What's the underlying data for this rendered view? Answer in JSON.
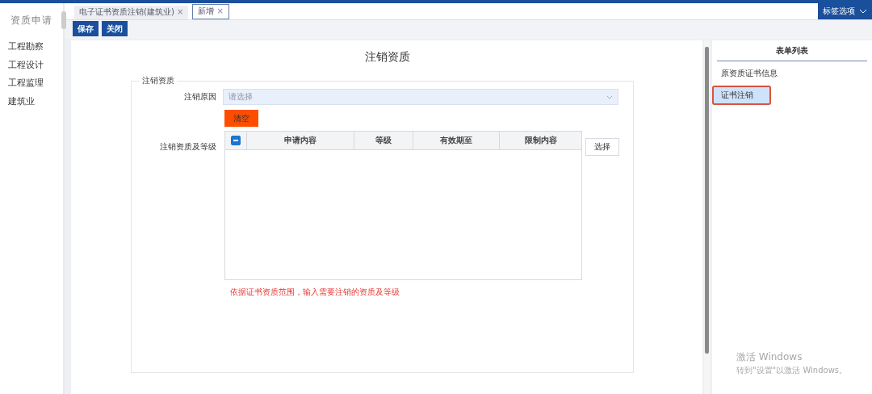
{
  "sidebar": {
    "title": "资质申请",
    "items": [
      {
        "label": "工程勘察",
        "selected": false
      },
      {
        "label": "工程设计",
        "selected": false
      },
      {
        "label": "工程监理",
        "selected": false
      },
      {
        "label": "建筑业",
        "selected": false
      }
    ]
  },
  "tabs": [
    {
      "label": "电子证书资质注销(建筑业)",
      "close": "×",
      "selected": false
    },
    {
      "label": "新增",
      "close": "×",
      "selected": true
    }
  ],
  "tab_options": "标签选项",
  "toolbar": [
    "保存",
    "关闭"
  ],
  "form": {
    "title": "注销资质",
    "section": "注销资质",
    "reason_label": "注销原因",
    "reason_placeholder": "请选择",
    "clear_button": "清空",
    "quals_label": "注销资质及等级",
    "select_button": "选择",
    "hint": "依据证书资质范围，输入需要注销的资质及等级",
    "table": {
      "header_checked": true,
      "columns": [
        "申请内容",
        "等级",
        "有效期至",
        "限制内容"
      ]
    }
  },
  "form_list": {
    "title": "表单列表",
    "items": [
      {
        "label": "原资质证书信息",
        "selected": false
      },
      {
        "label": "证书注销",
        "selected": true
      }
    ]
  },
  "activation": {
    "title": "激活 Windows",
    "text": "转到\"设置\"以激活 Windows。"
  }
}
